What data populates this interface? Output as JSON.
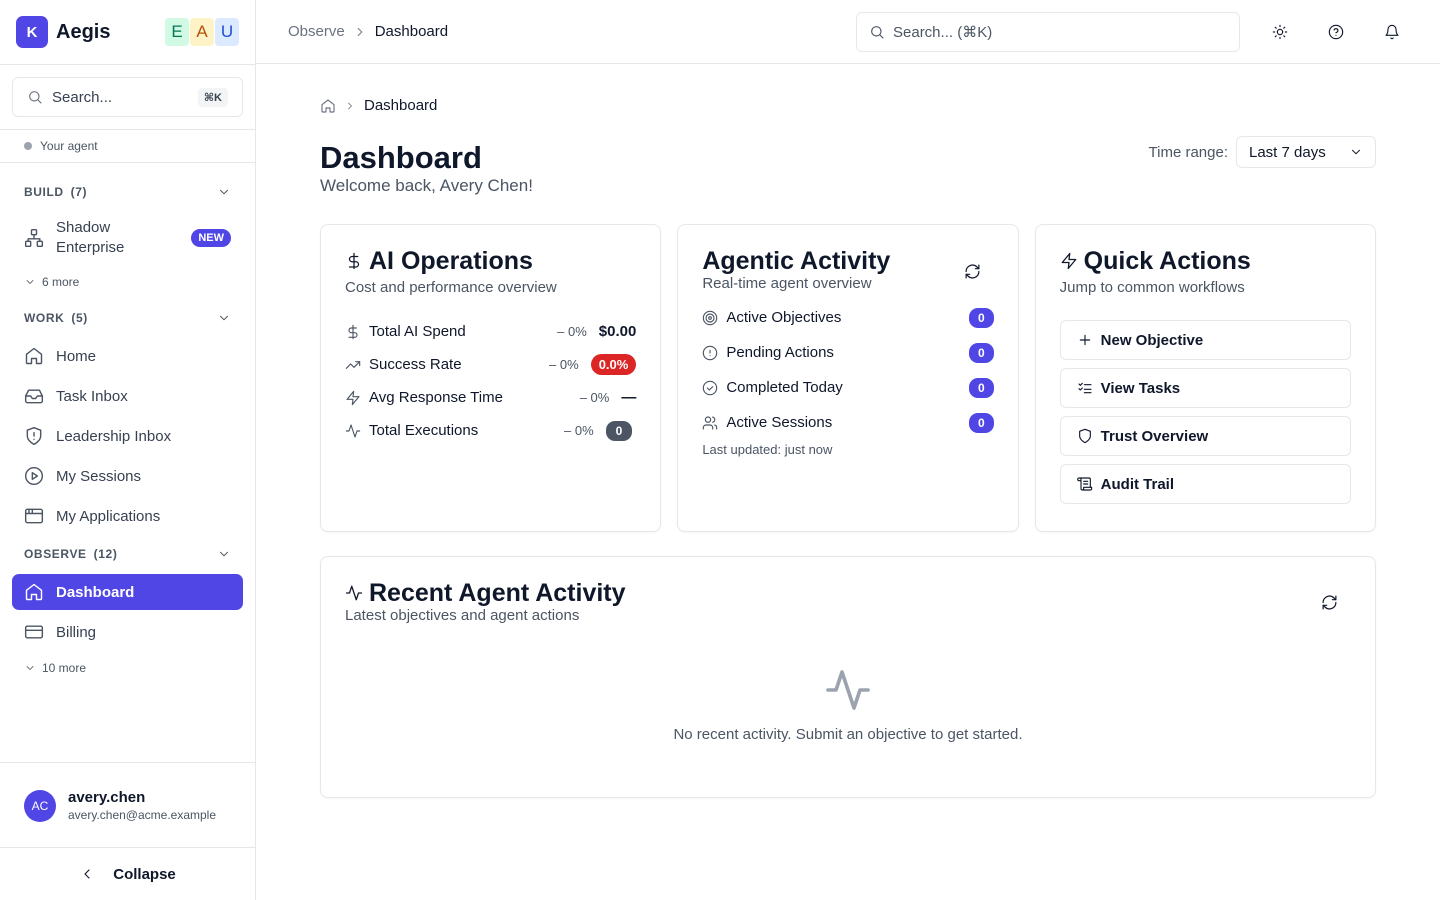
{
  "brand": {
    "logo_letter": "K",
    "name": "Aegis",
    "org_badges": [
      "E",
      "A",
      "U"
    ]
  },
  "sidebar": {
    "search_placeholder": "Search...",
    "search_shortcut": "⌘K",
    "agent_label": "Your agent",
    "sections": {
      "build": {
        "title": "BUILD",
        "count": "(7)",
        "more": "6 more",
        "items": [
          {
            "label": "Shadow Enterprise",
            "badge": "NEW",
            "icon": "network-icon"
          }
        ]
      },
      "work": {
        "title": "WORK",
        "count": "(5)",
        "items": [
          {
            "label": "Home",
            "icon": "home-icon"
          },
          {
            "label": "Task Inbox",
            "icon": "inbox-icon"
          },
          {
            "label": "Leadership Inbox",
            "icon": "shield-alert-icon"
          },
          {
            "label": "My Sessions",
            "icon": "play-circle-icon"
          },
          {
            "label": "My Applications",
            "icon": "app-window-icon"
          }
        ]
      },
      "observe": {
        "title": "OBSERVE",
        "count": "(12)",
        "more": "10 more",
        "items": [
          {
            "label": "Dashboard",
            "icon": "home-icon",
            "active": true
          },
          {
            "label": "Billing",
            "icon": "credit-card-icon"
          }
        ]
      }
    },
    "user": {
      "initials": "AC",
      "name": "avery.chen",
      "email": "avery.chen@acme.example"
    },
    "collapse_label": "Collapse"
  },
  "topbar": {
    "breadcrumb": [
      "Observe",
      "Dashboard"
    ],
    "search_placeholder": "Search... (⌘K)",
    "icons": [
      "sun-icon",
      "help-icon",
      "bell-icon"
    ]
  },
  "page": {
    "breadcrumb": "Dashboard",
    "title": "Dashboard",
    "welcome": "Welcome back, Avery Chen!",
    "time_range_label": "Time range:",
    "time_range_value": "Last 7 days"
  },
  "ai_operations": {
    "title": "AI Operations",
    "subtitle": "Cost and performance overview",
    "metrics": [
      {
        "label": "Total AI Spend",
        "delta": "– 0%",
        "value": "$0.00"
      },
      {
        "label": "Success Rate",
        "delta": "– 0%",
        "value": "0.0%"
      },
      {
        "label": "Avg Response Time",
        "delta": "– 0%",
        "value": "—"
      },
      {
        "label": "Total Executions",
        "delta": "– 0%",
        "value": "0"
      }
    ]
  },
  "agentic_activity": {
    "title": "Agentic Activity",
    "subtitle": "Real-time agent overview",
    "rows": [
      {
        "label": "Active Objectives",
        "count": "0"
      },
      {
        "label": "Pending Actions",
        "count": "0"
      },
      {
        "label": "Completed Today",
        "count": "0"
      },
      {
        "label": "Active Sessions",
        "count": "0"
      }
    ],
    "updated": "Last updated: just now"
  },
  "quick_actions": {
    "title": "Quick Actions",
    "subtitle": "Jump to common workflows",
    "buttons": [
      "New Objective",
      "View Tasks",
      "Trust Overview",
      "Audit Trail"
    ]
  },
  "recent_activity": {
    "title": "Recent Agent Activity",
    "subtitle": "Latest objectives and agent actions",
    "empty_text": "No recent activity. Submit an objective to get started."
  },
  "colors": {
    "accent": "#4f46e5",
    "danger": "#dc2626",
    "muted": "#4b5563"
  }
}
